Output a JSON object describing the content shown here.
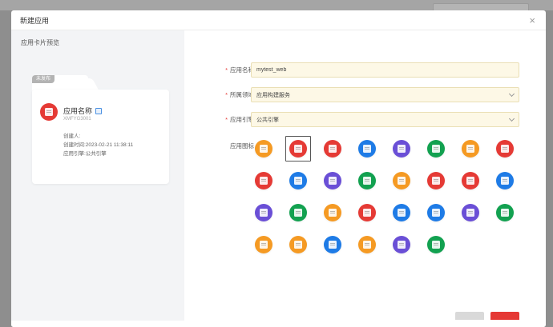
{
  "modal": {
    "title": "新建应用",
    "close_glyph": "×"
  },
  "preview": {
    "title": "应用卡片预览",
    "card": {
      "badge": "未发布",
      "name": "应用名称",
      "code": "XMFYG3001",
      "creator": "创建人:",
      "created_time": "创建时间:2023-02-21 11:38:11",
      "engine": "应用引擎:公共引擎",
      "icon_color": "#e53a35"
    }
  },
  "form": {
    "name": {
      "label": "应用名称",
      "value": "mytest_web"
    },
    "domain": {
      "label": "所属领域",
      "value": "应用构建服务"
    },
    "engine": {
      "label": "应用引擎",
      "value": "公共引擎"
    },
    "icons_label": "应用图标"
  },
  "icons": [
    {
      "name": "briefcase-icon",
      "color": "#f59a23"
    },
    {
      "name": "image-icon",
      "color": "#e53a35",
      "selected": true
    },
    {
      "name": "edit-doc-icon",
      "color": "#e53a35"
    },
    {
      "name": "doc-search-icon",
      "color": "#1e7be6"
    },
    {
      "name": "checklist-icon",
      "color": "#6a4fd6"
    },
    {
      "name": "doc-gear-icon",
      "color": "#12a150"
    },
    {
      "name": "clipboard-icon",
      "color": "#f59a23"
    },
    {
      "name": "bookmark-icon",
      "color": "#e53a35"
    },
    {
      "name": "document-icon",
      "color": "#e53a35"
    },
    {
      "name": "clipboard-list-icon",
      "color": "#1e7be6"
    },
    {
      "name": "toolbox-icon",
      "color": "#6a4fd6"
    },
    {
      "name": "monitor-icon",
      "color": "#12a150"
    },
    {
      "name": "clipboard-user-icon",
      "color": "#f59a23"
    },
    {
      "name": "flag-icon",
      "color": "#e53a35"
    },
    {
      "name": "grid-icon",
      "color": "#e53a35"
    },
    {
      "name": "list-icon",
      "color": "#1e7be6"
    },
    {
      "name": "report-icon",
      "color": "#6a4fd6"
    },
    {
      "name": "screen-icon",
      "color": "#12a150"
    },
    {
      "name": "file-icon",
      "color": "#f59a23"
    },
    {
      "name": "file-edit-icon",
      "color": "#e53a35"
    },
    {
      "name": "database-icon",
      "color": "#1e7be6"
    },
    {
      "name": "chart-doc-icon",
      "color": "#1e7be6"
    },
    {
      "name": "pen-doc-icon",
      "color": "#6a4fd6"
    },
    {
      "name": "note-icon",
      "color": "#12a150"
    },
    {
      "name": "target-icon",
      "color": "#f59a23"
    },
    {
      "name": "bar-chart-icon",
      "color": "#f59a23"
    },
    {
      "name": "form-icon",
      "color": "#1e7be6"
    },
    {
      "name": "stats-icon",
      "color": "#f59a23"
    },
    {
      "name": "box-icon",
      "color": "#6a4fd6"
    },
    {
      "name": "spreadsheet-icon",
      "color": "#12a150"
    }
  ]
}
